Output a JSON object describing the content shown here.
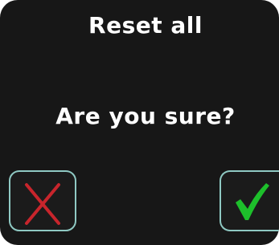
{
  "dialog": {
    "title": "Reset all",
    "message": "Are you sure?"
  },
  "buttons": {
    "cancel": {
      "icon": "x-icon",
      "color": "#c8252c"
    },
    "confirm": {
      "icon": "checkmark-icon",
      "color": "#1dbf2b"
    }
  },
  "colors": {
    "background": "#171717",
    "text": "#ffffff",
    "button_border": "#8fc9c3"
  }
}
